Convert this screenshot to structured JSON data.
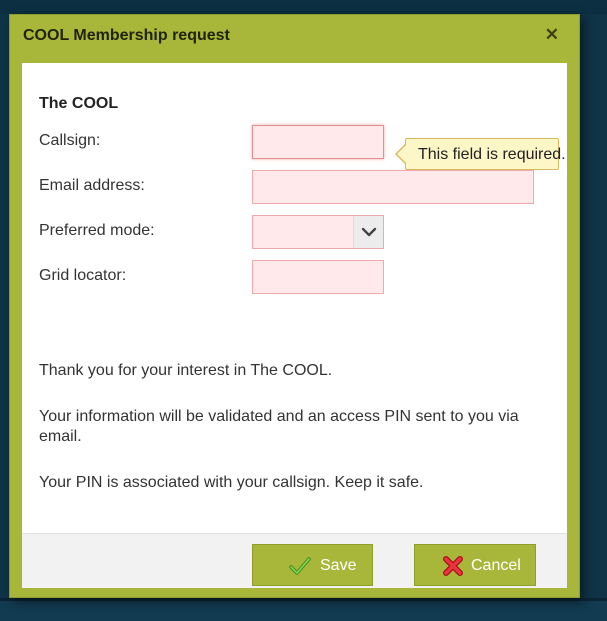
{
  "dialog": {
    "title": "COOL Membership request",
    "close_glyph": "✕"
  },
  "form": {
    "section_title": "The COOL",
    "fields": [
      {
        "label": "Callsign:",
        "value": "",
        "state": "required-error"
      },
      {
        "label": "Email address:",
        "value": "",
        "state": "required-error"
      },
      {
        "label": "Preferred mode:",
        "value": "",
        "state": "required-error"
      },
      {
        "label": "Grid locator:",
        "value": "",
        "state": "required-error"
      }
    ],
    "tooltip": "This field is required."
  },
  "info": {
    "p1": "Thank you for your interest in The COOL.",
    "p2": "Your information will be validated and an access PIN sent to you via email.",
    "p3": "Your PIN is associated with your callsign. Keep it safe."
  },
  "footer": {
    "save_label": "Save",
    "cancel_label": "Cancel",
    "save_icon": "check-icon",
    "cancel_icon": "x-icon"
  },
  "colors": {
    "accent": "#a8b73a",
    "error_fill": "#ffe9ea",
    "error_border": "#f2a9ad",
    "tooltip_bg": "#fdf6c6",
    "page_bg": "#0f3347"
  }
}
